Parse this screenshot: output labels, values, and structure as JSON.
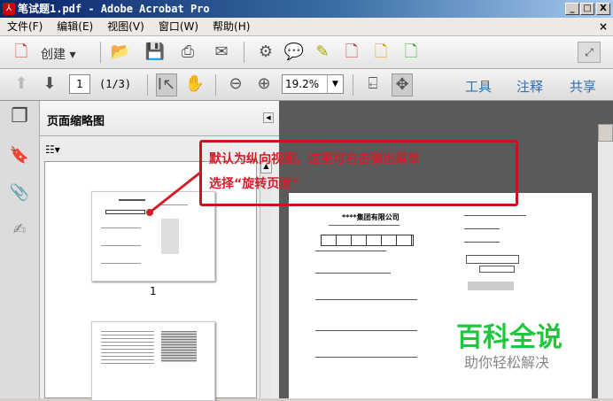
{
  "window": {
    "title": "笔试题1.pdf - Adobe Acrobat Pro",
    "minimize": "_",
    "maximize": "□",
    "close": "X",
    "doc_close": "×"
  },
  "menu": [
    "文件(F)",
    "编辑(E)",
    "视图(V)",
    "窗口(W)",
    "帮助(H)"
  ],
  "toolbar": {
    "create_label": "创建 ▾"
  },
  "nav": {
    "page_value": "1",
    "page_count": "(1/3)",
    "zoom_value": "19.2%",
    "tools": "工具",
    "comment": "注释",
    "share": "共享"
  },
  "panel": {
    "title": "页面缩略图",
    "thumb_label": "1"
  },
  "annotation": {
    "line1": "默认为纵向视图，这里可右击弹出菜单",
    "line2": "选择“旋转页面”"
  },
  "document": {
    "heading": "****集团有限公司"
  },
  "watermark": {
    "title": "百科全说",
    "subtitle": "助你轻松解决"
  }
}
